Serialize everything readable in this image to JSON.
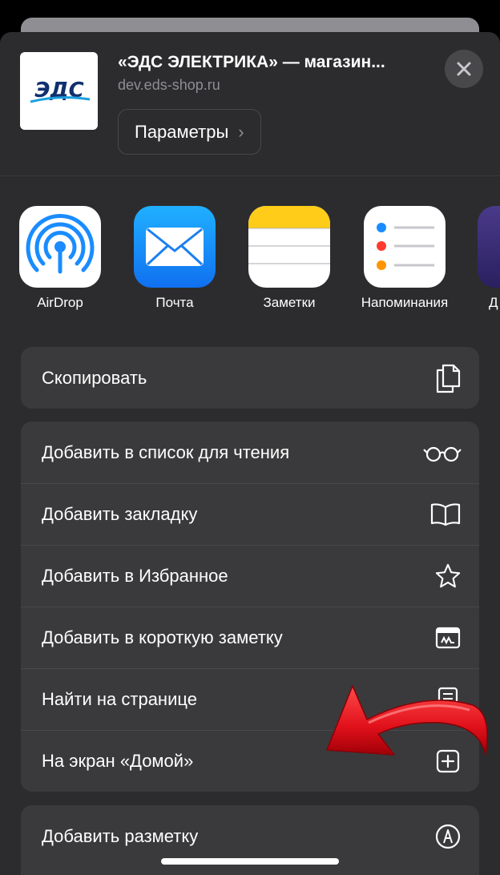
{
  "header": {
    "site_title": "«ЭДС ЭЛЕКТРИКА» — магазин...",
    "site_url": "dev.eds-shop.ru",
    "logo_text": "ЭДС",
    "params_label": "Параметры",
    "chevron": "›"
  },
  "apps": [
    {
      "label": "AirDrop",
      "icon": "airdrop-icon"
    },
    {
      "label": "Почта",
      "icon": "mail-icon"
    },
    {
      "label": "Заметки",
      "icon": "notes-icon"
    },
    {
      "label": "Напоминания",
      "icon": "reminders-icon"
    },
    {
      "label": "Д",
      "icon": "partial-app-icon"
    }
  ],
  "actions_group1": [
    {
      "label": "Скопировать",
      "icon": "copy-icon"
    }
  ],
  "actions_group2": [
    {
      "label": "Добавить в список для чтения",
      "icon": "glasses-icon"
    },
    {
      "label": "Добавить закладку",
      "icon": "book-icon"
    },
    {
      "label": "Добавить в Избранное",
      "icon": "star-icon"
    },
    {
      "label": "Добавить в короткую заметку",
      "icon": "quick-note-icon"
    },
    {
      "label": "Найти на странице",
      "icon": "find-icon"
    },
    {
      "label": "На экран «Домой»",
      "icon": "add-square-icon"
    }
  ],
  "actions_group3": [
    {
      "label": "Добавить разметку",
      "icon": "markup-icon"
    }
  ],
  "colors": {
    "sheet_bg": "#2c2c2e",
    "row_bg": "#3a3a3c",
    "accent_blue": "#1a8cff",
    "annotation_red": "#e0101a"
  }
}
